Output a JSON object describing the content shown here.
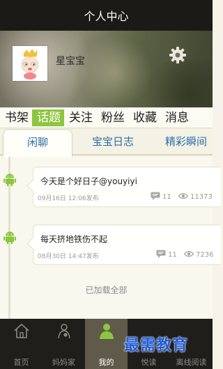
{
  "header": {
    "title": "个人中心"
  },
  "profile": {
    "username": "星宝宝"
  },
  "tabs": [
    "书架",
    "话题",
    "关注",
    "粉丝",
    "收藏",
    "消息"
  ],
  "subtabs": [
    "闲聊",
    "宝宝日志",
    "精彩瞬间"
  ],
  "posts": [
    {
      "text": "今天是个好日子@youyiyi",
      "time": "09月16日 12:06发布",
      "comments": "11",
      "views": "11373"
    },
    {
      "text": "每天挤地铁伤不起",
      "time": "08月30日 14:47发布",
      "comments": "11",
      "views": "7236"
    }
  ],
  "status": {
    "loaded": "已加载全部"
  },
  "bottom_nav": [
    {
      "label": "首页",
      "icon": "home-icon"
    },
    {
      "label": "妈妈家",
      "icon": "mom-icon"
    },
    {
      "label": "我的",
      "icon": "person-icon"
    },
    {
      "label": "悦读",
      "icon": "read-icon"
    },
    {
      "label": "离线阅读",
      "icon": "offline-icon"
    }
  ],
  "watermark": {
    "text": "最需教育"
  },
  "colors": {
    "accent": "#8cc63f",
    "link": "#2c6ea8",
    "titlebar": "#1b1a17"
  }
}
